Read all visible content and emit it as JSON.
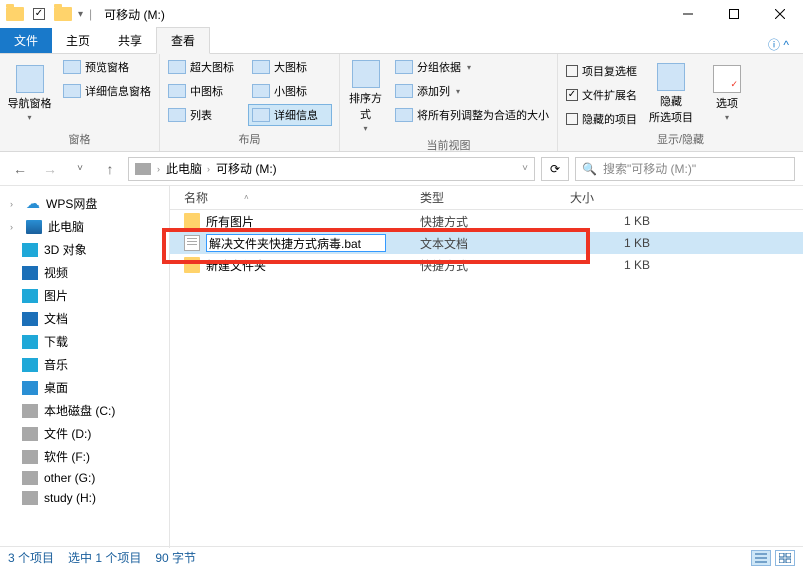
{
  "title": "可移动 (M:)",
  "tabs": {
    "file": "文件",
    "home": "主页",
    "share": "共享",
    "view": "查看"
  },
  "ribbon": {
    "pane_group": {
      "nav_pane": "导航窗格",
      "preview": "预览窗格",
      "details": "详细信息窗格",
      "label": "窗格"
    },
    "layout_group": {
      "xl": "超大图标",
      "lg": "大图标",
      "md": "中图标",
      "sm": "小图标",
      "list": "列表",
      "details": "详细信息",
      "label": "布局"
    },
    "cur_group": {
      "sort": "排序方式",
      "group": "分组依据",
      "addcol": "添加列",
      "fit": "将所有列调整为合适的大小",
      "label": "当前视图"
    },
    "show_group": {
      "checkboxes": "项目复选框",
      "ext": "文件扩展名",
      "hidden_items": "隐藏的项目",
      "hide": "隐藏\n所选项目",
      "options": "选项",
      "label": "显示/隐藏"
    }
  },
  "nav": {
    "breadcrumb": [
      "此电脑",
      "可移动 (M:)"
    ],
    "search_placeholder": "搜索\"可移动 (M:)\""
  },
  "sidebar": {
    "items": [
      {
        "label": "WPS网盘",
        "kind": "cloud",
        "top": true
      },
      {
        "label": "此电脑",
        "kind": "pc",
        "top": true
      },
      {
        "label": "3D 对象",
        "kind": "3d"
      },
      {
        "label": "视频",
        "kind": "vid"
      },
      {
        "label": "图片",
        "kind": "pic"
      },
      {
        "label": "文档",
        "kind": "doc"
      },
      {
        "label": "下载",
        "kind": "dl"
      },
      {
        "label": "音乐",
        "kind": "mus"
      },
      {
        "label": "桌面",
        "kind": "desk"
      },
      {
        "label": "本地磁盘 (C:)",
        "kind": "drv"
      },
      {
        "label": "文件 (D:)",
        "kind": "drv"
      },
      {
        "label": "软件 (F:)",
        "kind": "drv"
      },
      {
        "label": "other (G:)",
        "kind": "drv"
      },
      {
        "label": "study (H:)",
        "kind": "drv"
      }
    ]
  },
  "columns": {
    "name": "名称",
    "type": "类型",
    "size": "大小"
  },
  "files": [
    {
      "name": "所有图片",
      "type": "快捷方式",
      "size": "1 KB",
      "icon": "folder"
    },
    {
      "name": "解决文件夹快捷方式病毒.bat",
      "type": "文本文档",
      "size": "1 KB",
      "icon": "txt",
      "selected": true,
      "renaming": true
    },
    {
      "name": "新建文件夹",
      "type": "快捷方式",
      "size": "1 KB",
      "icon": "folder"
    }
  ],
  "status": {
    "count": "3 个项目",
    "selected": "选中 1 个项目",
    "bytes": "90 字节"
  }
}
